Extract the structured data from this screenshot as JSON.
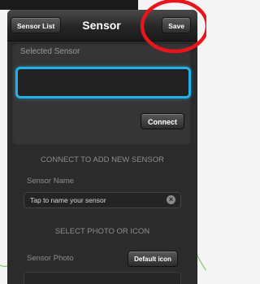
{
  "nav": {
    "back_label": "Sensor List",
    "title": "Sensor",
    "save_label": "Save"
  },
  "selected_sensor": {
    "label": "Selected Sensor",
    "value": "",
    "connect_label": "Connect"
  },
  "new_sensor": {
    "heading": "CONNECT TO ADD NEW SENSOR",
    "name_label": "Sensor Name",
    "name_placeholder": "Tap to name your sensor",
    "clear_icon": "clear-circle-icon"
  },
  "photo": {
    "heading": "SELECT PHOTO OR ICON",
    "label": "Sensor Photo",
    "default_icon_label": "Default icon"
  },
  "colors": {
    "accent_blue": "#22b2e6",
    "annotation_red": "#e8151b",
    "annotation_green": "#6cc24a"
  }
}
